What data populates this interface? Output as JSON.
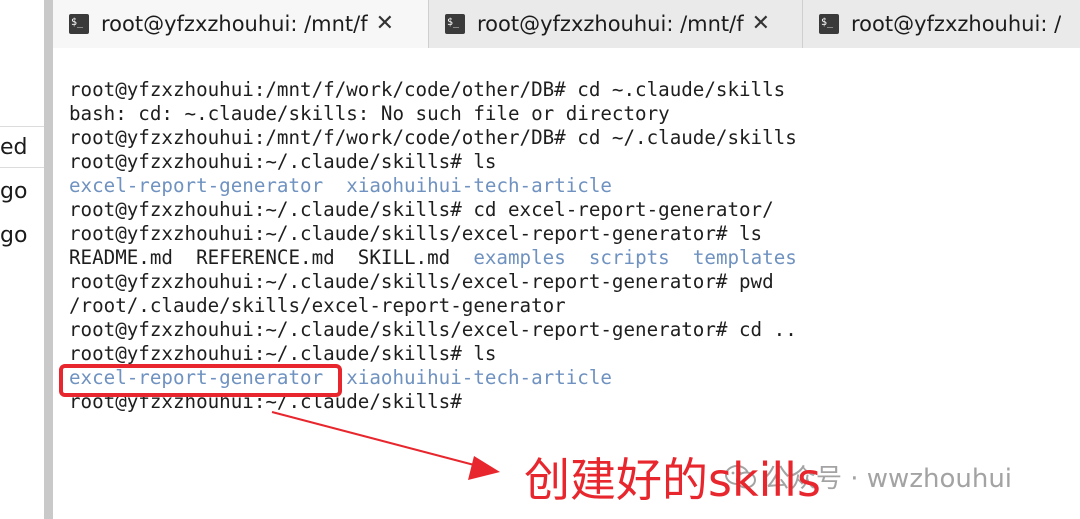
{
  "left_window": {
    "fragments": [
      "ed",
      "go",
      "go"
    ]
  },
  "tabs": [
    {
      "title": "root@yfzxzhouhui: /mnt/f",
      "icon": "terminal-icon"
    },
    {
      "title": "root@yfzxzhouhui: /mnt/f",
      "icon": "terminal-icon"
    },
    {
      "title": "root@yfzxzhouhui: /",
      "icon": "terminal-icon"
    }
  ],
  "close_glyph": "✕",
  "terminal": {
    "lines": [
      [
        {
          "text": "root@yfzxzhouhui:/mnt/f/work/code/other/DB# cd ~.claude/skills"
        }
      ],
      [
        {
          "text": "bash: cd: ~.claude/skills: No such file or directory"
        }
      ],
      [
        {
          "text": "root@yfzxzhouhui:/mnt/f/work/code/other/DB# cd ~/.claude/skills"
        }
      ],
      [
        {
          "text": "root@yfzxzhouhui:~/.claude/skills# ls"
        }
      ],
      [
        {
          "text": "excel-report-generator",
          "dir": true
        },
        {
          "text": "  "
        },
        {
          "text": "xiaohuihui-tech-article",
          "dir": true
        }
      ],
      [
        {
          "text": "root@yfzxzhouhui:~/.claude/skills# cd excel-report-generator/"
        }
      ],
      [
        {
          "text": "root@yfzxzhouhui:~/.claude/skills/excel-report-generator# ls"
        }
      ],
      [
        {
          "text": "README.md  REFERENCE.md  SKILL.md  "
        },
        {
          "text": "examples",
          "dir": true
        },
        {
          "text": "  "
        },
        {
          "text": "scripts",
          "dir": true
        },
        {
          "text": "  "
        },
        {
          "text": "templates",
          "dir": true
        }
      ],
      [
        {
          "text": "root@yfzxzhouhui:~/.claude/skills/excel-report-generator# pwd"
        }
      ],
      [
        {
          "text": "/root/.claude/skills/excel-report-generator"
        }
      ],
      [
        {
          "text": "root@yfzxzhouhui:~/.claude/skills/excel-report-generator# cd .."
        }
      ],
      [
        {
          "text": "root@yfzxzhouhui:~/.claude/skills# ls"
        }
      ],
      [
        {
          "text": "excel-report-generator",
          "dir": true
        },
        {
          "text": "  "
        },
        {
          "text": "xiaohuihui-tech-article",
          "dir": true
        }
      ],
      [
        {
          "text": "root@yfzxzhouhui:~/.claude/skills#"
        }
      ]
    ]
  },
  "annotation": {
    "text": "创建好的skills",
    "color": "#e8262d"
  },
  "watermark": {
    "text": "公众号 · wwzhouhui"
  }
}
